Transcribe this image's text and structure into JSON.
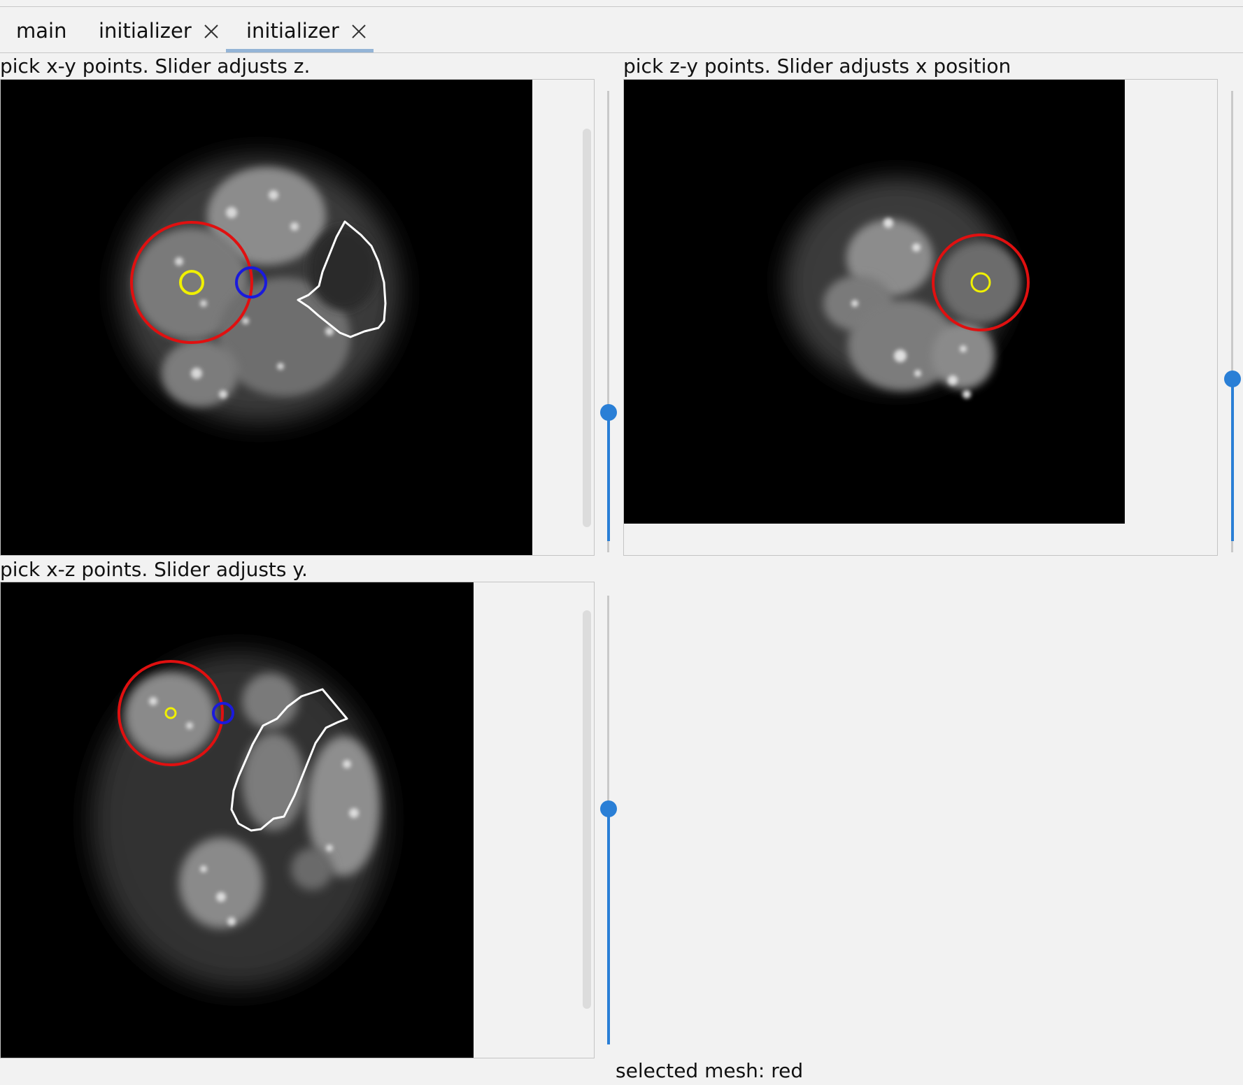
{
  "tabs": [
    {
      "label": "main",
      "closable": false,
      "active": false
    },
    {
      "label": "initializer",
      "closable": true,
      "active": false
    },
    {
      "label": "initializer",
      "closable": true,
      "active": true
    }
  ],
  "panels": {
    "xy": {
      "title": "pick x-y points. Slider adjusts z.",
      "slider_fraction": 0.29
    },
    "zy": {
      "title": "pick z-y points. Slider adjusts x position",
      "slider_fraction": 0.36
    },
    "xz": {
      "title": "pick x-z points. Slider adjusts y.",
      "slider_fraction": 0.52
    }
  },
  "status": {
    "label": "selected mesh:",
    "value": "red"
  },
  "colors": {
    "accent": "#2a7fd6",
    "mesh_red": "#e01010",
    "mesh_blue": "#1a1adc",
    "point_yellow": "#f0f000",
    "outline_white": "#ffffff"
  },
  "icons": {
    "tab_close": "close-icon"
  }
}
